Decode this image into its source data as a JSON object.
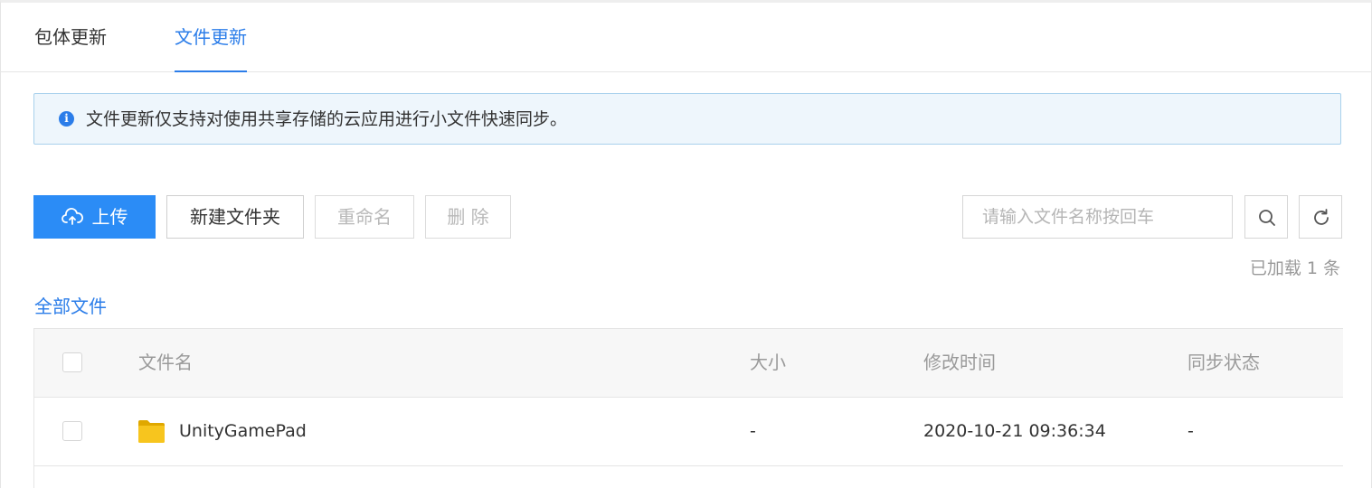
{
  "tabs": [
    {
      "label": "包体更新",
      "active": false
    },
    {
      "label": "文件更新",
      "active": true
    }
  ],
  "notice": {
    "text": "文件更新仅支持对使用共享存储的云应用进行小文件快速同步。",
    "icon": "info-icon"
  },
  "toolbar": {
    "upload_label": "上传",
    "new_folder_label": "新建文件夹",
    "rename_label": "重命名",
    "delete_label": "删 除",
    "search_placeholder": "请输入文件名称按回车",
    "search_value": ""
  },
  "loaded_text": "已加载 1 条",
  "breadcrumb": "全部文件",
  "table": {
    "columns": [
      "文件名",
      "大小",
      "修改时间",
      "同步状态"
    ],
    "rows": [
      {
        "name": "UnityGamePad",
        "size": "-",
        "modified": "2020-10-21 09:36:34",
        "sync": "-",
        "type": "folder"
      }
    ]
  },
  "colors": {
    "accent": "#2b7de9",
    "primary_button": "#2b8cf6",
    "notice_bg": "#eef6fc",
    "folder": "#f5c518"
  }
}
